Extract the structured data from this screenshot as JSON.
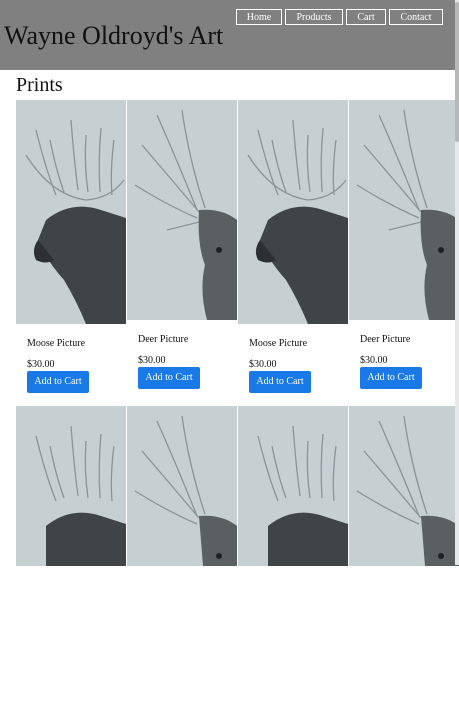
{
  "header": {
    "title": "Wayne Oldroyd's Art",
    "nav": [
      "Home",
      "Products",
      "Cart",
      "Contact"
    ]
  },
  "page": {
    "title": "Prints"
  },
  "products": [
    {
      "name": "Moose Picture",
      "price": "$30.00",
      "button": "Add to Cart",
      "icon": "moose-drawing"
    },
    {
      "name": "Deer Picture",
      "price": "$30.00",
      "button": "Add to Cart",
      "icon": "deer-drawing"
    },
    {
      "name": "Moose Picture",
      "price": "$30.00",
      "button": "Add to Cart",
      "icon": "moose-drawing"
    },
    {
      "name": "Deer Picture",
      "price": "$30.00",
      "button": "Add to Cart",
      "icon": "deer-drawing"
    }
  ],
  "colors": {
    "header": "#808080",
    "button": "#1979e6",
    "art_bg": "#c6d0d3"
  }
}
